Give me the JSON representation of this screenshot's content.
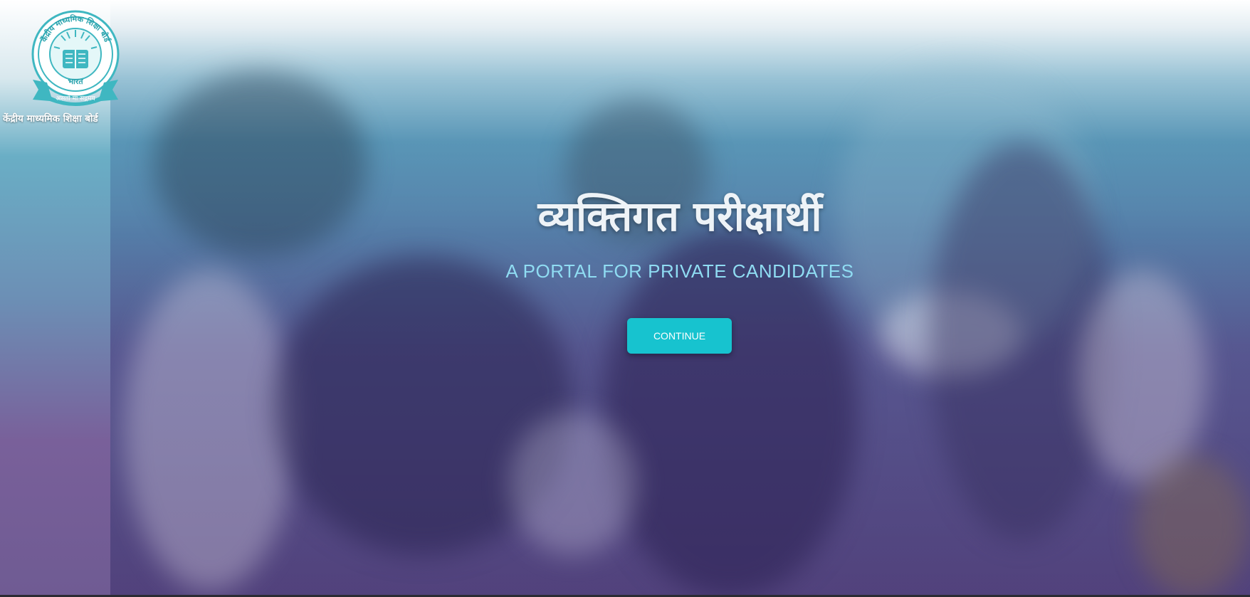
{
  "header": {
    "logo_icon": "cbse-emblem-icon",
    "logo_top_text": "केंद्रीय माध्यमिक शिक्षा बोर्ड",
    "logo_country": "भारत",
    "logo_motto": "असतो मा सद्गमय",
    "org_name": "केंद्रीय माध्यमिक शिक्षा बोर्ड"
  },
  "hero": {
    "title": "व्यक्तिगत परीक्षार्थी",
    "subtitle": "A PORTAL FOR PRIVATE CANDIDATES",
    "continue_label": "CONTINUE",
    "background_icon": "students-photo"
  },
  "colors": {
    "accent": "#17c3cf",
    "subtitle": "#8fdcf2",
    "emblem": "#3fb7c1"
  }
}
